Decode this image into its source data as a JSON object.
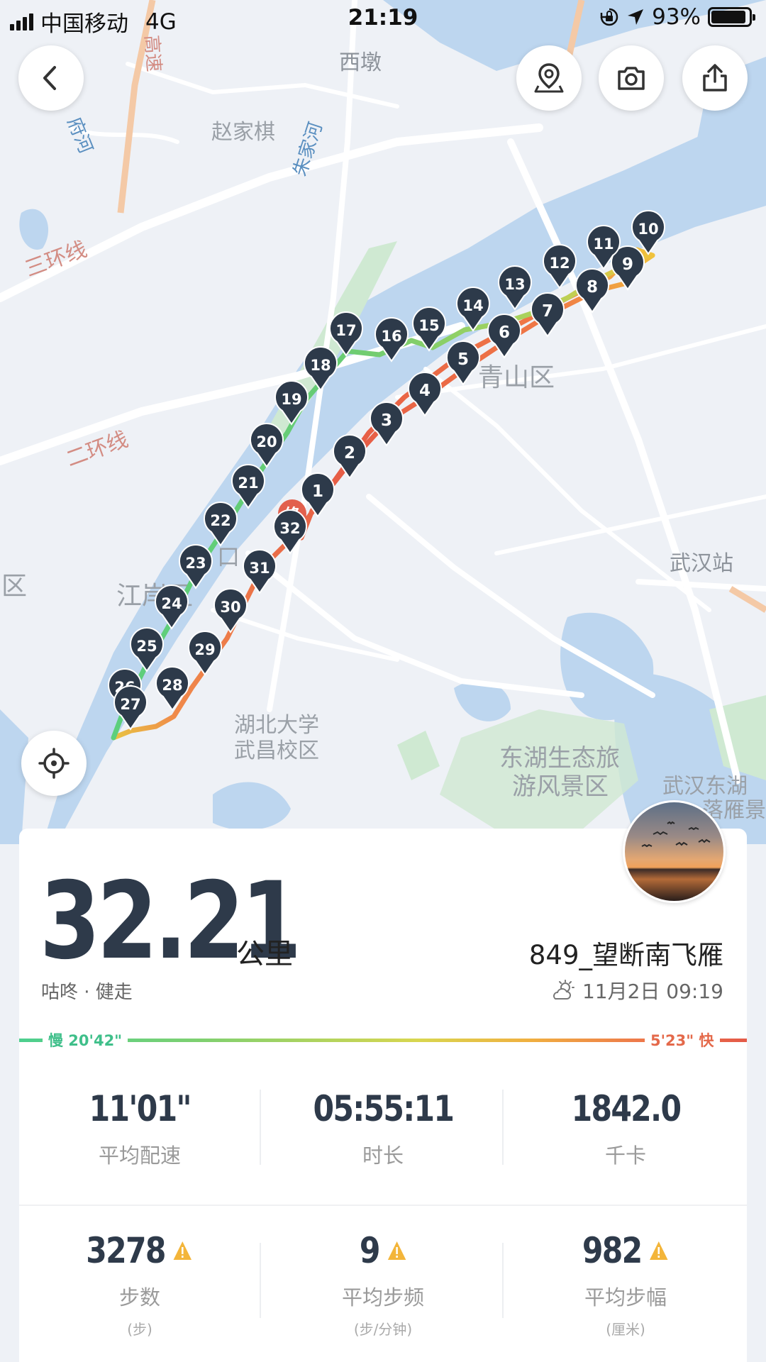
{
  "status_bar": {
    "carrier": "中国移动",
    "network": "4G",
    "time": "21:19",
    "battery": "93%",
    "battery_level": 0.93
  },
  "map": {
    "labels": [
      {
        "text": "西墩",
        "name": "map-label-xidun"
      },
      {
        "text": "赵家棋",
        "name": "map-label-zhaojiaqi"
      },
      {
        "text": "府河",
        "name": "map-label-fuhe"
      },
      {
        "text": "朱家河",
        "name": "map-label-zhujiahe"
      },
      {
        "text": "三环线",
        "name": "map-label-sanhuanxian"
      },
      {
        "text": "二环线",
        "name": "map-label-erhuanxian"
      },
      {
        "text": "青山区",
        "name": "map-label-qingshan"
      },
      {
        "text": "江岸区",
        "name": "map-label-jiangan"
      },
      {
        "text": "区",
        "name": "map-label-qu"
      },
      {
        "text": "武汉站",
        "name": "map-label-wuhan-station"
      },
      {
        "text": "湖北大学",
        "name": "map-label-hubei-univ"
      },
      {
        "text": "武昌校区",
        "name": "map-label-wuchang-campus"
      },
      {
        "text": "东湖生态旅",
        "name": "map-label-donghu-1"
      },
      {
        "text": "游风景区",
        "name": "map-label-donghu-2"
      },
      {
        "text": "武汉东湖",
        "name": "map-label-wuhan-donghu"
      },
      {
        "text": "落雁景",
        "name": "map-label-luoyan"
      },
      {
        "text": "高速",
        "name": "map-label-highway"
      },
      {
        "text": "口",
        "name": "map-label-kou"
      }
    ],
    "km_markers": [
      "1",
      "2",
      "3",
      "4",
      "5",
      "6",
      "7",
      "8",
      "9",
      "10",
      "11",
      "12",
      "13",
      "14",
      "15",
      "16",
      "17",
      "18",
      "19",
      "20",
      "21",
      "22",
      "23",
      "24",
      "25",
      "26",
      "27",
      "28",
      "29",
      "30",
      "31",
      "32"
    ],
    "start_marker": "终",
    "marker_color": "#2d3a4a"
  },
  "buttons": {
    "back": "back-arrow-icon",
    "location_pin": "location-pin-icon",
    "camera": "camera-icon",
    "share": "share-icon",
    "recenter": "crosshair-icon"
  },
  "summary": {
    "distance": "32.21",
    "unit": "公里",
    "sport": "咕咚 · 健走",
    "username": "849_望断南飞雁",
    "date": "11月2日 09:19",
    "weather_icon": "partly-cloudy-icon"
  },
  "speed_legend": {
    "slow": "慢 20'42\"",
    "fast": "5'23\" 快",
    "slow_color": "#4ccf8f",
    "fast_color": "#e45a48"
  },
  "stats": {
    "pace": {
      "value": "11'01\"",
      "label": "平均配速"
    },
    "duration": {
      "value": "05:55:11",
      "label": "时长"
    },
    "calories": {
      "value": "1842.0",
      "label": "千卡"
    },
    "steps": {
      "value": "3278",
      "label": "步数",
      "sub": "(步)"
    },
    "cadence": {
      "value": "9",
      "label": "平均步频",
      "sub": "(步/分钟)"
    },
    "stride": {
      "value": "982",
      "label": "平均步幅",
      "sub": "(厘米)"
    }
  }
}
